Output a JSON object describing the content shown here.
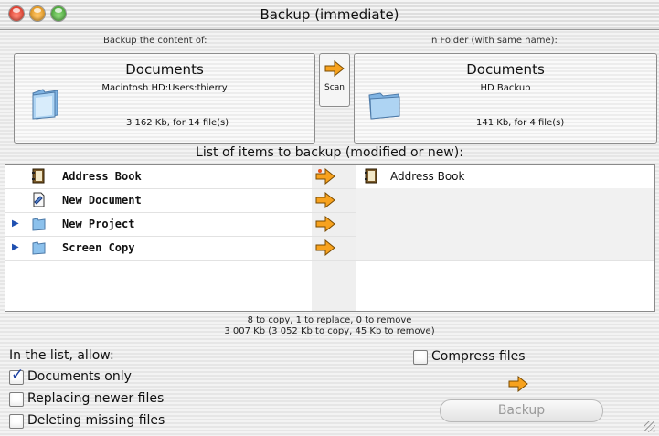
{
  "window": {
    "title": "Backup (immediate)"
  },
  "source": {
    "heading": "Backup the content of:",
    "name": "Documents",
    "path": "Macintosh HD:Users:thierry",
    "size": "3 162 Kb, for 14 file(s)"
  },
  "scan": {
    "label": "Scan"
  },
  "destination": {
    "heading": "In Folder (with same name):",
    "name": "Documents",
    "path": "HD Backup",
    "size": "141 Kb, for 4 file(s)"
  },
  "list": {
    "title": "List of items to backup (modified or new):",
    "items": [
      {
        "name": "Address Book",
        "icon": "address-book-icon",
        "dest": "Address Book",
        "replace": true
      },
      {
        "name": "New Document",
        "icon": "document-icon",
        "dest": "",
        "replace": false
      },
      {
        "name": "New Project",
        "icon": "folder-icon",
        "dest": "",
        "replace": false
      },
      {
        "name": "Screen Copy",
        "icon": "folder-icon",
        "dest": "",
        "replace": false
      }
    ]
  },
  "summary": {
    "line1": "8 to copy, 1 to replace, 0 to remove",
    "line2": "3 007 Kb (3 052 Kb to copy, 45 Kb to remove)"
  },
  "options": {
    "heading": "In the list, allow:",
    "documents_only": {
      "label": "Documents only",
      "checked": true
    },
    "replacing_newer": {
      "label": "Replacing newer files",
      "checked": false
    },
    "deleting_missing": {
      "label": "Deleting missing files",
      "checked": false
    },
    "compress": {
      "label": "Compress files",
      "checked": false
    }
  },
  "backup_button": {
    "label": "Backup",
    "enabled": false
  },
  "colors": {
    "arrow": "#f7a21e",
    "replace_arrow": "#e8541c",
    "folder": "#8cc1ec",
    "selection": "#1a3fa0"
  }
}
